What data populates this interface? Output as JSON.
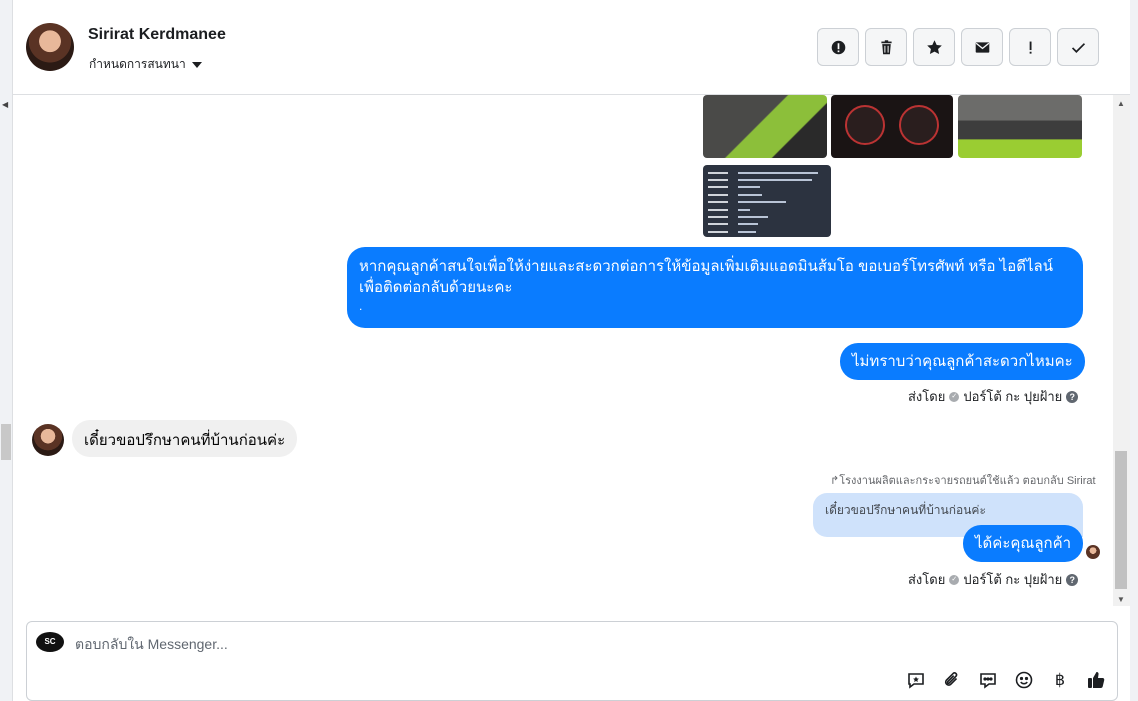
{
  "header": {
    "contact_name": "Sirirat Kerdmanee",
    "assign_label": "กำหนดการสนทนา",
    "actions": [
      {
        "name": "report-spam-button",
        "icon": "alert-circle-icon"
      },
      {
        "name": "delete-button",
        "icon": "trash-icon"
      },
      {
        "name": "star-button",
        "icon": "star-icon"
      },
      {
        "name": "mark-unread-button",
        "icon": "envelope-icon"
      },
      {
        "name": "follow-up-button",
        "icon": "exclamation-icon"
      },
      {
        "name": "mark-done-button",
        "icon": "checkmark-icon"
      }
    ]
  },
  "messages": {
    "outgoing_1_line1": "หากคุณลูกค้าสนใจเพื่อให้ง่ายและสะดวกต่อการให้ข้อมูลเพิ่มเติมแอดมินส้มโอ ขอเบอร์โทรศัพท์ หรือ ไอดีไลน์",
    "outgoing_1_line2": "เพื่อติดต่อกลับด้วยนะคะ",
    "outgoing_1_line3": ".",
    "outgoing_2": "ไม่ทราบว่าคุณลูกค้าสะดวกไหมคะ",
    "sent_by_1": "ส่งโดย",
    "sent_by_1_name": "ปอร์โต้ กะ ปุยฝ้าย",
    "incoming_1": "เดี๋ยวขอปรึกษาคนที่บ้านก่อนค่ะ",
    "reply_note": "โรงงานผลิตและกระจายรถยนต์ใช้แล้ว ตอบกลับ Sirirat",
    "reply_quote": "เดี๋ยวขอปรึกษาคนที่บ้านก่อนค่ะ",
    "outgoing_3": "ได้ค่ะคุณลูกค้า",
    "sent_by_2": "ส่งโดย",
    "sent_by_2_name": "ปอร์โต้ กะ ปุยฝ้าย"
  },
  "composer": {
    "placeholder": "ตอบกลับใน Messenger...",
    "page_logo_text": "SC",
    "tools": [
      "saved-reply-icon",
      "attachment-icon",
      "chat-bubble-icon",
      "emoji-icon",
      "baht-icon",
      "like-icon"
    ],
    "baht_symbol": "฿"
  }
}
